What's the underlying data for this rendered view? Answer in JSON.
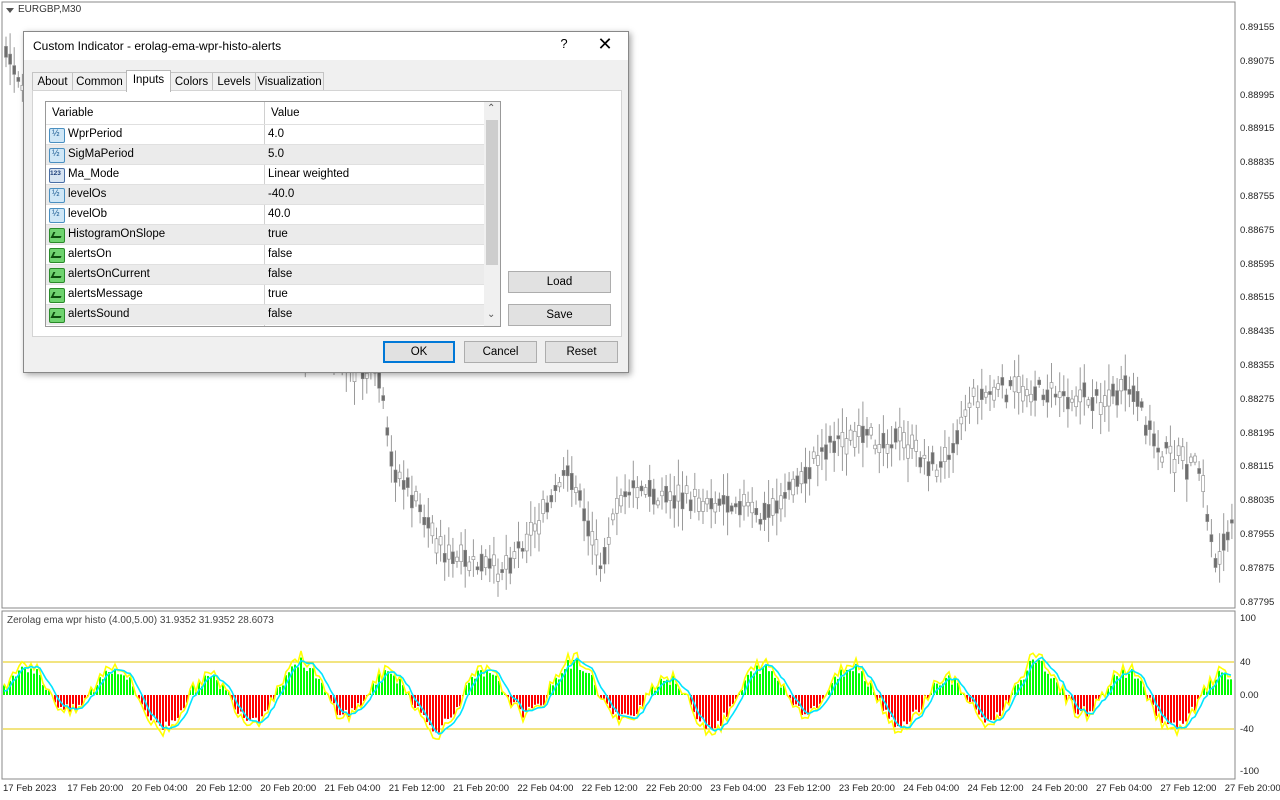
{
  "chart": {
    "symbol": "EURGBP,M30",
    "subwindow_label": "Zerolag ema wpr histo (4.00,5.00) 31.9352 31.9352 28.6073",
    "price_labels": [
      "0.89155",
      "0.89075",
      "0.88995",
      "0.88915",
      "0.88835",
      "0.88755",
      "0.88675",
      "0.88595",
      "0.88515",
      "0.88435",
      "0.88355",
      "0.88275",
      "0.88195",
      "0.88115",
      "0.88035",
      "0.87955",
      "0.87875",
      "0.87795"
    ],
    "indicator_labels": [
      "100",
      "40",
      "0.00",
      "-40",
      "-100"
    ],
    "time_labels": [
      "17 Feb 2023",
      "17 Feb 20:00",
      "20 Feb 04:00",
      "20 Feb 12:00",
      "20 Feb 20:00",
      "21 Feb 04:00",
      "21 Feb 12:00",
      "21 Feb 20:00",
      "22 Feb 04:00",
      "22 Feb 12:00",
      "22 Feb 20:00",
      "23 Feb 04:00",
      "23 Feb 12:00",
      "23 Feb 20:00",
      "24 Feb 04:00",
      "24 Feb 12:00",
      "24 Feb 20:00",
      "27 Feb 04:00",
      "27 Feb 12:00",
      "27 Feb 20:00"
    ],
    "colors": {
      "up": "#00ff00",
      "down": "#ff0000",
      "signal": "#00e5ff",
      "wpr": "#ffff00",
      "levels": "#e6c800",
      "candles": "#808080"
    }
  },
  "dialog": {
    "title": "Custom Indicator - erolag-ema-wpr-histo-alerts",
    "help_label": "?",
    "close_icon": "✕",
    "tabs": [
      "About",
      "Common",
      "Inputs",
      "Colors",
      "Levels",
      "Visualization"
    ],
    "active_tab": "Inputs",
    "columns": {
      "variable": "Variable",
      "value": "Value"
    },
    "rows": [
      {
        "type": "double",
        "variable": "WprPeriod",
        "value": "4.0"
      },
      {
        "type": "double",
        "variable": "SigMaPeriod",
        "value": "5.0"
      },
      {
        "type": "enum",
        "variable": "Ma_Mode",
        "value": "Linear weighted"
      },
      {
        "type": "double",
        "variable": "levelOs",
        "value": "-40.0"
      },
      {
        "type": "double",
        "variable": "levelOb",
        "value": "40.0"
      },
      {
        "type": "bool",
        "variable": "HistogramOnSlope",
        "value": "true"
      },
      {
        "type": "bool",
        "variable": "alertsOn",
        "value": "false"
      },
      {
        "type": "bool",
        "variable": "alertsOnCurrent",
        "value": "false"
      },
      {
        "type": "bool",
        "variable": "alertsMessage",
        "value": "true"
      },
      {
        "type": "bool",
        "variable": "alertsSound",
        "value": "false"
      }
    ],
    "buttons": {
      "load": "Load",
      "save": "Save",
      "ok": "OK",
      "cancel": "Cancel",
      "reset": "Reset"
    }
  }
}
